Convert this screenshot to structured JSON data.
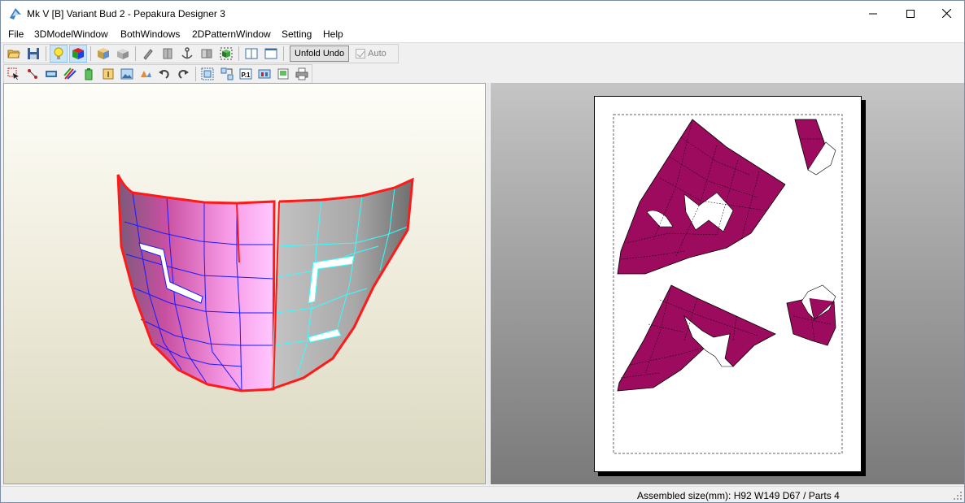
{
  "window": {
    "title": "Mk V [B] Variant Bud 2 - Pepakura Designer 3",
    "minimize_icon": "minimize-icon",
    "maximize_icon": "maximize-icon",
    "close_icon": "close-icon"
  },
  "menu": [
    "File",
    "3DModelWindow",
    "BothWindows",
    "2DPatternWindow",
    "Setting",
    "Help"
  ],
  "toolbar": {
    "unfold_undo_label": "Unfold Undo",
    "auto_label": "Auto",
    "auto_checked": true
  },
  "colors": {
    "part_fill": "#9c0b5e",
    "selected_edge": "#ff0000",
    "cut_edge_left": "#0000ff",
    "cut_edge_right": "#00ffff"
  },
  "status": {
    "text": "Assembled size(mm): H92 W149 D67 / Parts 4"
  }
}
